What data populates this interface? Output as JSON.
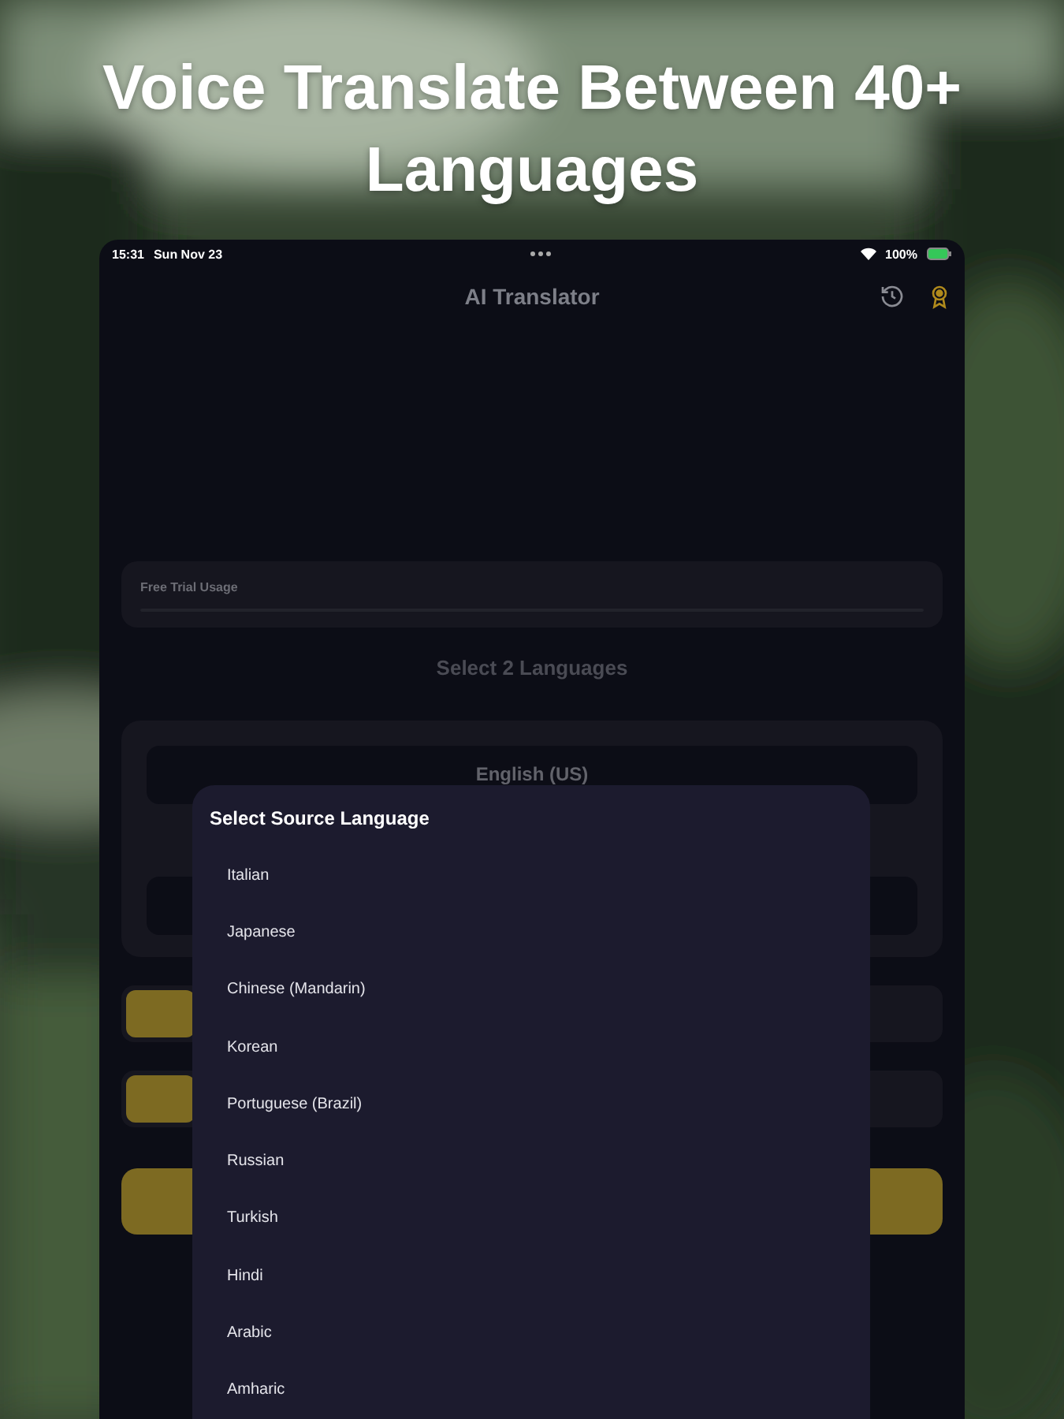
{
  "headline": "Voice Translate Between 40+ Languages",
  "status_bar": {
    "time": "15:31",
    "date": "Sun Nov 23",
    "battery": "100%"
  },
  "nav": {
    "title": "AI Translator"
  },
  "trial": {
    "label": "Free Trial Usage"
  },
  "prompt": "Select 2 Languages",
  "languages": {
    "first": "English (US)"
  },
  "sheet": {
    "title": "Select Source Language",
    "items": [
      "Italian",
      "Japanese",
      "Chinese (Mandarin)",
      "Korean",
      "Portuguese (Brazil)",
      "Russian",
      "Turkish",
      "Hindi",
      "Arabic",
      "Amharic"
    ]
  }
}
